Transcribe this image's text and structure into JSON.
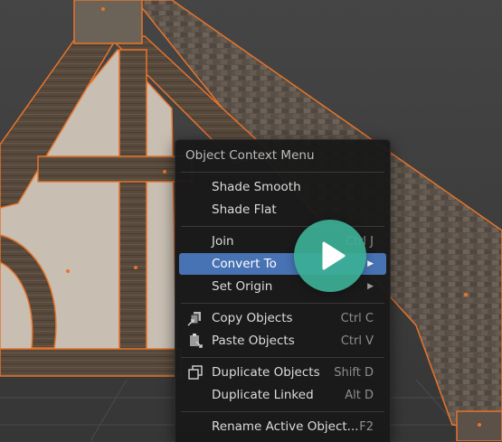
{
  "menu": {
    "title": "Object Context Menu",
    "items": [
      {
        "label": "Shade Smooth",
        "shortcut": ""
      },
      {
        "label": "Shade Flat",
        "shortcut": ""
      },
      {
        "label": "Join",
        "shortcut": "Ctrl J"
      },
      {
        "label": "Convert To",
        "shortcut": "",
        "submenu": true,
        "highlighted": true
      },
      {
        "label": "Set Origin",
        "shortcut": "",
        "submenu": true
      },
      {
        "label": "Copy Objects",
        "shortcut": "Ctrl C",
        "icon": "copy-icon"
      },
      {
        "label": "Paste Objects",
        "shortcut": "Ctrl V",
        "icon": "paste-icon"
      },
      {
        "label": "Duplicate Objects",
        "shortcut": "Shift D",
        "icon": "duplicate-icon"
      },
      {
        "label": "Duplicate Linked",
        "shortcut": "Alt D"
      },
      {
        "label": "Rename Active Object...",
        "shortcut": "F2"
      }
    ],
    "submenu_arrow": "▶"
  },
  "overlay": {
    "icon": "play-icon",
    "color": "#3caf96"
  },
  "colors": {
    "highlight": "#4772b3",
    "selection_outline": "#e8742a",
    "menu_background": "#181818"
  }
}
